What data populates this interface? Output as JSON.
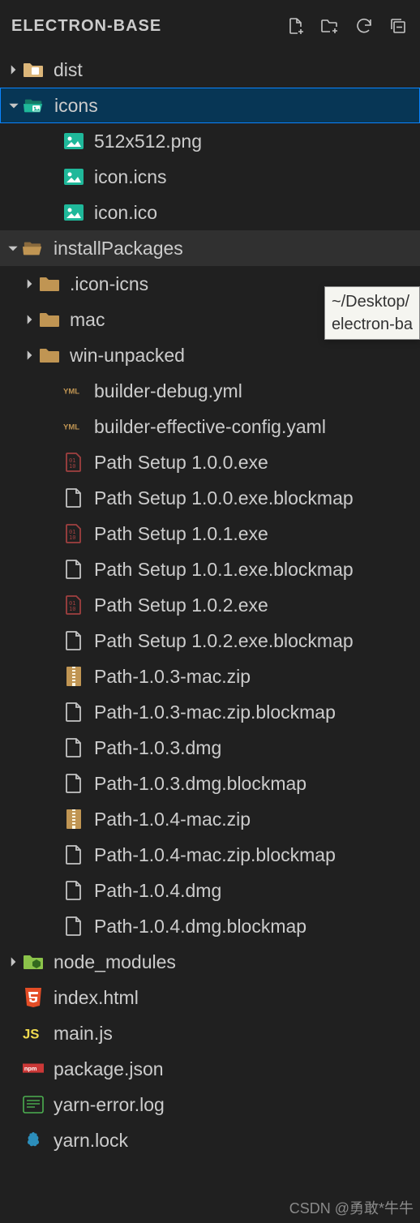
{
  "header": {
    "title": "ELECTRON-BASE"
  },
  "tree": [
    {
      "label": "dist",
      "indent": 0,
      "twistie": "right",
      "icon": "folder-yellow"
    },
    {
      "label": "icons",
      "indent": 0,
      "twistie": "down",
      "icon": "folder-image-open",
      "selected": true
    },
    {
      "label": "512x512.png",
      "indent": 2,
      "twistie": "",
      "icon": "image"
    },
    {
      "label": "icon.icns",
      "indent": 2,
      "twistie": "",
      "icon": "image"
    },
    {
      "label": "icon.ico",
      "indent": 2,
      "twistie": "",
      "icon": "image"
    },
    {
      "label": "installPackages",
      "indent": 0,
      "twistie": "down",
      "icon": "folder-open-brown",
      "highlighted": true
    },
    {
      "label": ".icon-icns",
      "indent": 1,
      "twistie": "right",
      "icon": "folder-brown"
    },
    {
      "label": "mac",
      "indent": 1,
      "twistie": "right",
      "icon": "folder-brown"
    },
    {
      "label": "win-unpacked",
      "indent": 1,
      "twistie": "right",
      "icon": "folder-brown"
    },
    {
      "label": "builder-debug.yml",
      "indent": 2,
      "twistie": "",
      "icon": "yaml"
    },
    {
      "label": "builder-effective-config.yaml",
      "indent": 2,
      "twistie": "",
      "icon": "yaml"
    },
    {
      "label": "Path Setup 1.0.0.exe",
      "indent": 2,
      "twistie": "",
      "icon": "exe"
    },
    {
      "label": "Path Setup 1.0.0.exe.blockmap",
      "indent": 2,
      "twistie": "",
      "icon": "file"
    },
    {
      "label": "Path Setup 1.0.1.exe",
      "indent": 2,
      "twistie": "",
      "icon": "exe"
    },
    {
      "label": "Path Setup 1.0.1.exe.blockmap",
      "indent": 2,
      "twistie": "",
      "icon": "file"
    },
    {
      "label": "Path Setup 1.0.2.exe",
      "indent": 2,
      "twistie": "",
      "icon": "exe"
    },
    {
      "label": "Path Setup 1.0.2.exe.blockmap",
      "indent": 2,
      "twistie": "",
      "icon": "file"
    },
    {
      "label": "Path-1.0.3-mac.zip",
      "indent": 2,
      "twistie": "",
      "icon": "zip"
    },
    {
      "label": "Path-1.0.3-mac.zip.blockmap",
      "indent": 2,
      "twistie": "",
      "icon": "file"
    },
    {
      "label": "Path-1.0.3.dmg",
      "indent": 2,
      "twistie": "",
      "icon": "file"
    },
    {
      "label": "Path-1.0.3.dmg.blockmap",
      "indent": 2,
      "twistie": "",
      "icon": "file"
    },
    {
      "label": "Path-1.0.4-mac.zip",
      "indent": 2,
      "twistie": "",
      "icon": "zip"
    },
    {
      "label": "Path-1.0.4-mac.zip.blockmap",
      "indent": 2,
      "twistie": "",
      "icon": "file"
    },
    {
      "label": "Path-1.0.4.dmg",
      "indent": 2,
      "twistie": "",
      "icon": "file"
    },
    {
      "label": "Path-1.0.4.dmg.blockmap",
      "indent": 2,
      "twistie": "",
      "icon": "file"
    },
    {
      "label": "node_modules",
      "indent": 0,
      "twistie": "right",
      "icon": "folder-node"
    },
    {
      "label": "index.html",
      "indent": 0,
      "twistie": "",
      "icon": "html"
    },
    {
      "label": "main.js",
      "indent": 0,
      "twistie": "",
      "icon": "js"
    },
    {
      "label": "package.json",
      "indent": 0,
      "twistie": "",
      "icon": "npm"
    },
    {
      "label": "yarn-error.log",
      "indent": 0,
      "twistie": "",
      "icon": "log"
    },
    {
      "label": "yarn.lock",
      "indent": 0,
      "twistie": "",
      "icon": "yarn"
    }
  ],
  "tooltip": {
    "line1": "~/Desktop/",
    "line2": "electron-ba"
  },
  "watermark": "CSDN @勇敢*牛牛"
}
